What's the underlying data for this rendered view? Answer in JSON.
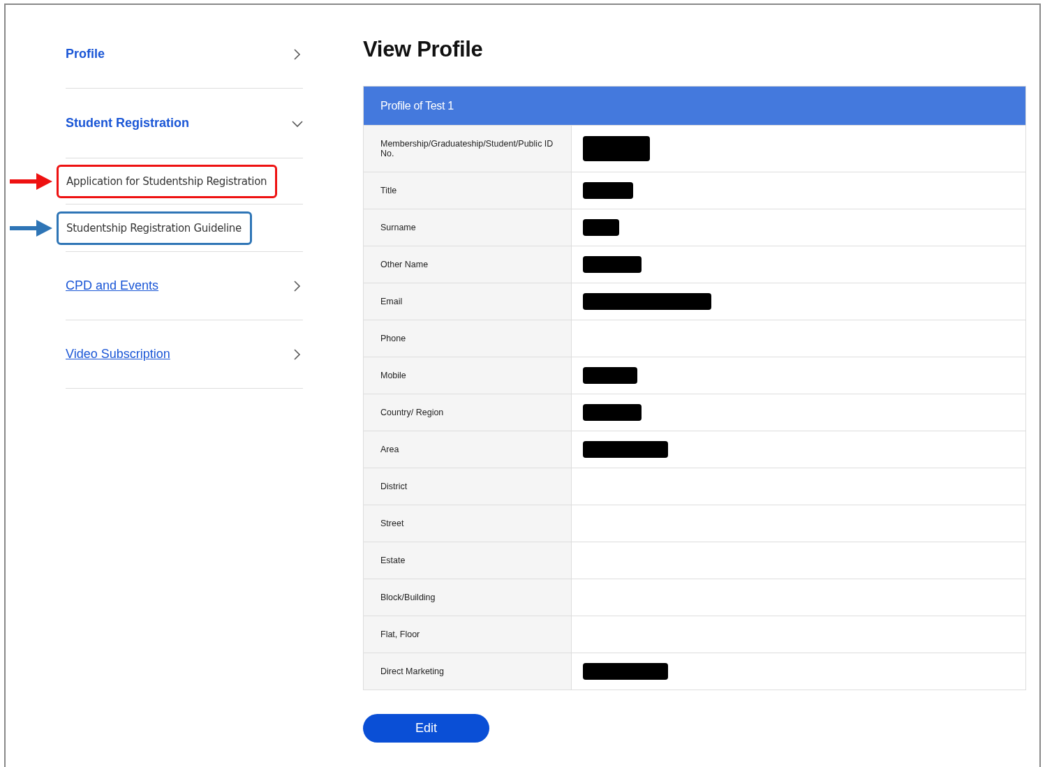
{
  "sidebar": {
    "items": [
      {
        "label": "Profile",
        "kind": "section",
        "expanded": false
      },
      {
        "label": "Student Registration",
        "kind": "section",
        "expanded": true,
        "children": [
          {
            "label": "Application for Studentship Registration",
            "color": "#ee1111"
          },
          {
            "label": "Studentship Registration Guideline",
            "color": "#2e75b6"
          }
        ]
      },
      {
        "label": "CPD and Events",
        "kind": "link",
        "expanded": false
      },
      {
        "label": "Video Subscription",
        "kind": "link",
        "expanded": false
      }
    ]
  },
  "page_title": "View Profile",
  "profile_table": {
    "heading": "Profile of Test 1",
    "rows": [
      {
        "label": "Membership/Graduateship/Student/Public ID No.",
        "redacted": true
      },
      {
        "label": "Title",
        "redacted": true
      },
      {
        "label": "Surname",
        "redacted": true
      },
      {
        "label": "Other Name",
        "redacted": true
      },
      {
        "label": "Email",
        "redacted": true
      },
      {
        "label": "Phone",
        "redacted": false
      },
      {
        "label": "Mobile",
        "redacted": true
      },
      {
        "label": "Country/ Region",
        "redacted": true
      },
      {
        "label": "Area",
        "redacted": true
      },
      {
        "label": "District",
        "redacted": false
      },
      {
        "label": "Street",
        "redacted": false
      },
      {
        "label": "Estate",
        "redacted": false
      },
      {
        "label": "Block/Building",
        "redacted": false
      },
      {
        "label": "Flat, Floor",
        "redacted": false
      },
      {
        "label": "Direct Marketing",
        "redacted": true
      }
    ]
  },
  "edit_button": "Edit"
}
